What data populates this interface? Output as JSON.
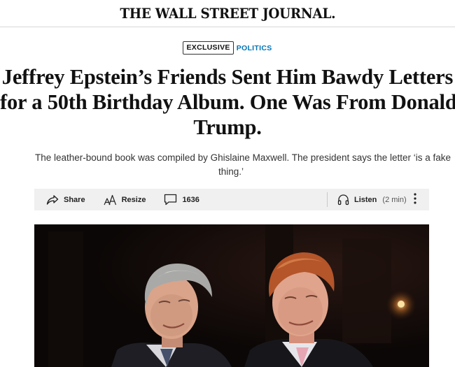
{
  "masthead": {
    "logo_text": "THE WALL STREET JOURNAL."
  },
  "flags": {
    "exclusive_label": "EXCLUSIVE",
    "section_label": "POLITICS"
  },
  "headline": {
    "line1": "Jeffrey Epstein’s Friends Sent Him Bawdy Letters",
    "line2": "for a 50th Birthday Album. One Was From Donald",
    "line3": "Trump."
  },
  "dek": {
    "line1": "The leather-bound book was compiled by Ghislaine Maxwell. The president says the letter ‘is a fake",
    "line2": "thing.’"
  },
  "toolbar": {
    "share_label": "Share",
    "resize_label": "Resize",
    "comment_count": "1636",
    "listen_label": "Listen",
    "listen_duration": "(2 min)"
  },
  "icons": {
    "share": "share-icon",
    "resize": "resize-icon",
    "comment": "comment-icon",
    "listen": "headphones-icon",
    "more": "more-vertical-icon"
  },
  "colors": {
    "section_flag": "#0274b6",
    "toolbar_background": "#f0f0f0",
    "masthead_rule": "#d7d7d7"
  }
}
